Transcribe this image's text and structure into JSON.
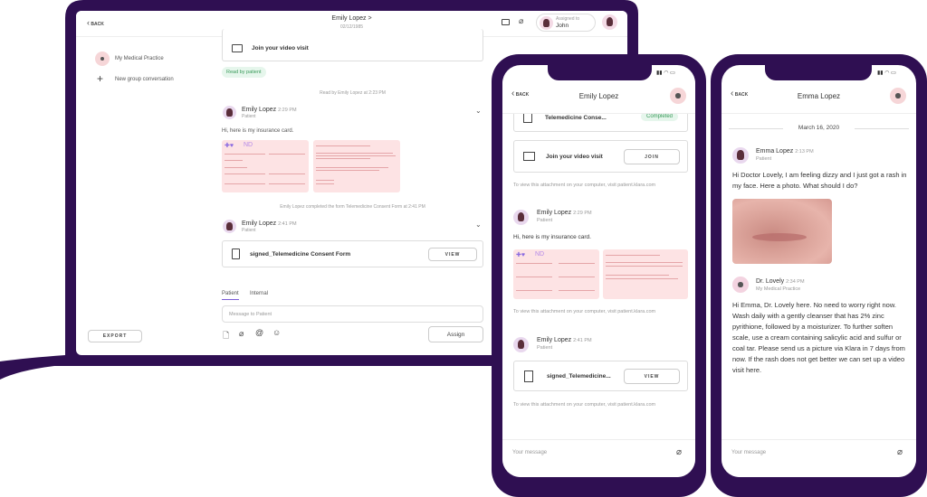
{
  "laptop": {
    "header": {
      "back": "BACK",
      "title": "Emily Lopez >",
      "subtitle": "02/12/1985",
      "assigned_label": "Assigned to",
      "assigned_name": "John"
    },
    "sidebar": {
      "practice": "My Medical Practice",
      "new_group": "New group conversation",
      "export": "EXPORT"
    },
    "video_card": "Join your video visit",
    "read_badge": "Read by patient",
    "read_status": "Read by Emily Lopez at 2:23 PM",
    "msg1": {
      "name": "Emily Lopez",
      "time": "2:29 PM",
      "role": "Patient",
      "text": "Hi, here is my insurance card.",
      "card_logo": "ND"
    },
    "event": "Emily Lopez completed the form Telemedicine Consent Form at 2:41 PM",
    "msg2": {
      "name": "Emily Lopez",
      "time": "2:41 PM",
      "role": "Patient",
      "file": "signed_Telemedicine Consent Form",
      "view": "VIEW"
    },
    "composer": {
      "tab_patient": "Patient",
      "tab_internal": "Internal",
      "placeholder": "Message to Patient",
      "assign": "Assign"
    }
  },
  "phone1": {
    "back": "BACK",
    "title": "Emily Lopez",
    "form_card": "Telemedicine Conse...",
    "form_status": "Completed",
    "video_card": "Join your video visit",
    "join": "JOIN",
    "attach_note": "To view this attachment on your computer, visit patient.klara.com",
    "msg1": {
      "name": "Emily Lopez",
      "time": "2:29 PM",
      "role": "Patient",
      "text": "Hi, here is my insurance card.",
      "card_logo": "ND"
    },
    "msg2": {
      "name": "Emily Lopez",
      "time": "2:41 PM",
      "role": "Patient",
      "file": "signed_Telemedicine...",
      "view": "VIEW"
    },
    "placeholder": "Your message"
  },
  "phone2": {
    "back": "BACK",
    "title": "Emma Lopez",
    "date": "March 16, 2020",
    "msg1": {
      "name": "Emma Lopez",
      "time": "2:13 PM",
      "role": "Patient",
      "text": "Hi Doctor Lovely, I am feeling dizzy and I just got a rash in my face. Here a photo. What should I do?"
    },
    "msg2": {
      "name": "Dr. Lovely",
      "time": "2:34 PM",
      "role": "My Medical Practice",
      "text": "Hi Emma, Dr. Lovely here. No need to worry right now. Wash daily with a gently cleanser that has 2% zinc pyrithione, followed by a moisturizer. To further soften scale, use a cream containing salicylic acid and sulfur or coal tar. Please send us a picture via Klara in 7 days from now. If the rash does not get better we can set up a video visit here."
    },
    "placeholder": "Your message"
  },
  "colors": {
    "frame": "#2f0f52",
    "accent": "#7b5cd6",
    "completed_bg": "#e6f6ec",
    "completed_text": "#3a9a5a",
    "insurance_bg": "#fde3e4"
  }
}
